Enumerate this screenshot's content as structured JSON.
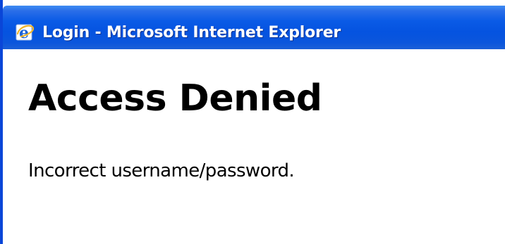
{
  "window": {
    "title": "Login - Microsoft Internet Explorer",
    "icon": "internet-explorer-icon",
    "title_bar_color": "#0553e0"
  },
  "page": {
    "heading": "Access Denied",
    "message": "Incorrect username/password."
  }
}
